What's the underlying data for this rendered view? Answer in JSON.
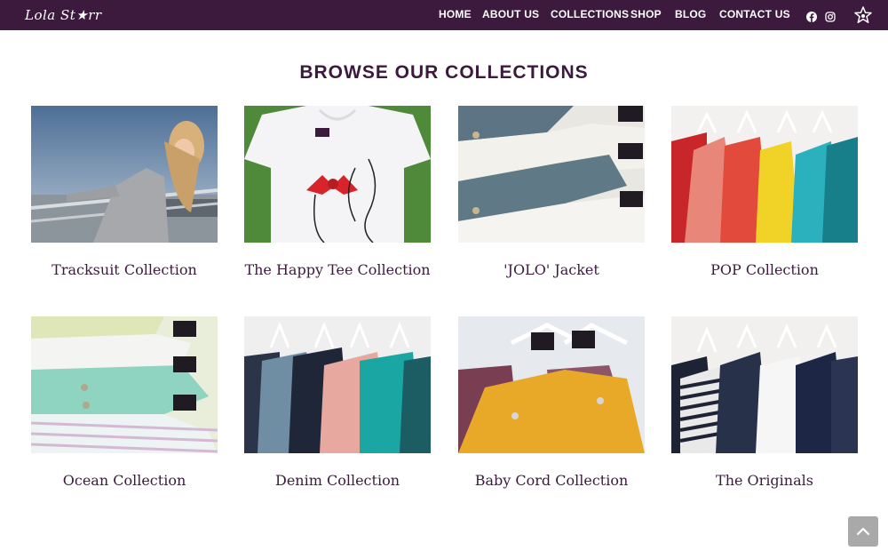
{
  "brand": {
    "logo_text": "Lola St★rr"
  },
  "nav": {
    "links": [
      "Home",
      "About Us",
      "Collections",
      "Shop",
      "Blog",
      "Contact Us"
    ],
    "social": [
      "facebook-icon",
      "instagram-icon"
    ],
    "cart_icon": "cart-star-icon"
  },
  "main": {
    "title": "Browse Our Collections",
    "collections": [
      {
        "title": "Tracksuit Collection"
      },
      {
        "title": "The Happy Tee Collection"
      },
      {
        "title": "'JOLO' Jacket"
      },
      {
        "title": "POP Collection"
      },
      {
        "title": "Ocean Collection"
      },
      {
        "title": "Denim Collection"
      },
      {
        "title": "Baby Cord Collection"
      },
      {
        "title": "The Originals"
      }
    ]
  },
  "colors": {
    "brand_purple": "#3c1a3e",
    "scroll_button": "#a9a9a9"
  },
  "scroll_top_icon": "chevron-up-icon"
}
